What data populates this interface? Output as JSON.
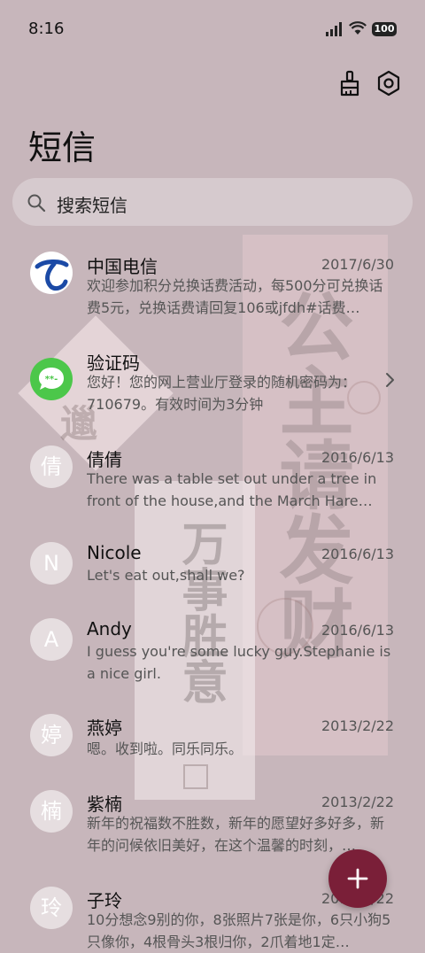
{
  "status": {
    "time": "8:16",
    "battery": "100"
  },
  "header": {
    "title": "短信",
    "clean_icon": "broom-icon",
    "settings_icon": "gear-icon"
  },
  "search": {
    "placeholder": "搜索短信"
  },
  "messages": [
    {
      "sender": "中国电信",
      "date": "2017/6/30",
      "preview": "欢迎参加积分兑换话费活动，每500分可兑换话费5元，兑换话费请回复106或jfdh#话费…",
      "avatar": ""
    },
    {
      "sender": "验证码",
      "date": "",
      "preview": "您好！您的网上营业厅登录的随机密码为：710679。有效时间为3分钟",
      "avatar": ""
    },
    {
      "sender": "倩倩",
      "date": "2016/6/13",
      "preview": "There was a table set out under a tree in front of the house,and the March Hare an…",
      "avatar": "倩"
    },
    {
      "sender": "Nicole",
      "date": "2016/6/13",
      "preview": "Let's eat out,shall we?",
      "avatar": "N"
    },
    {
      "sender": "Andy",
      "date": "2016/6/13",
      "preview": "I guess you're some lucky guy.Stephanie is a nice girl.",
      "avatar": "A"
    },
    {
      "sender": "燕婷",
      "date": "2013/2/22",
      "preview": "嗯。收到啦。同乐同乐。",
      "avatar": "婷"
    },
    {
      "sender": "紫楠",
      "date": "2013/2/22",
      "preview": "新年的祝福数不胜数，新年的愿望好多好多，新年的问候依旧美好，在这个温馨的时刻，…",
      "avatar": "楠"
    },
    {
      "sender": "子玲",
      "date": "2013/2/22",
      "preview": "10分想念9别的你，8张照片7张是你，6只小狗5只像你，4根骨头3根归你，2爪着地1定…",
      "avatar": "玲"
    }
  ],
  "decor": {
    "calligraphy_right": "公主请发财",
    "calligraphy_mid": "万事胜意",
    "diamond_text": "邋"
  },
  "colors": {
    "background": "#c7b6bb",
    "fab": "#7a1f38",
    "telecom_blue": "#1b4aa6",
    "code_green": "#4cc74a"
  }
}
